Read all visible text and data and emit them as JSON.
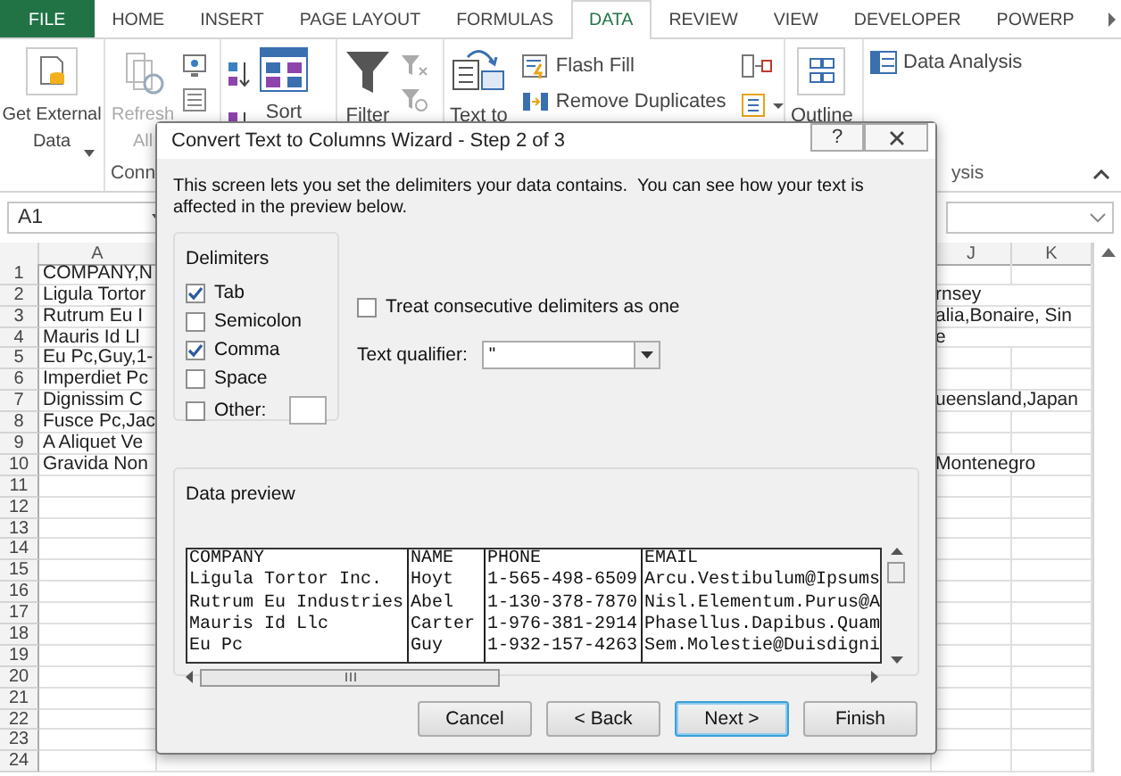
{
  "ribbon": {
    "tabs": [
      {
        "label": "FILE",
        "kind": "file",
        "selected": false
      },
      {
        "label": "HOME",
        "kind": "tab",
        "selected": false
      },
      {
        "label": "INSERT",
        "kind": "tab",
        "selected": false
      },
      {
        "label": "PAGE LAYOUT",
        "kind": "tab",
        "selected": false
      },
      {
        "label": "FORMULAS",
        "kind": "tab",
        "selected": false
      },
      {
        "label": "DATA",
        "kind": "tab",
        "selected": true
      },
      {
        "label": "REVIEW",
        "kind": "tab",
        "selected": false
      },
      {
        "label": "VIEW",
        "kind": "tab",
        "selected": false
      },
      {
        "label": "DEVELOPER",
        "kind": "tab",
        "selected": false
      },
      {
        "label": "POWERP",
        "kind": "tab",
        "selected": false
      }
    ],
    "get_external_data": "Get External Data",
    "refresh_all": {
      "label": "Refresh All",
      "disabled": true
    },
    "sort": "Sort",
    "filter": "Filter",
    "text_to_columns": "Text to",
    "flash_fill": "Flash Fill",
    "remove_duplicates": "Remove Duplicates",
    "outline": "Outline",
    "data_analysis": "Data Analysis",
    "group_labels": [
      "Conn",
      "ysis"
    ]
  },
  "name_box": {
    "value": "A1"
  },
  "sheet": {
    "columns": [
      "A",
      "J",
      "K"
    ],
    "rows": [
      {
        "number": "1",
        "column_a": "COMPANY,N"
      },
      {
        "number": "2",
        "column_a": "Ligula Tortor",
        "column_j": "rnsey"
      },
      {
        "number": "3",
        "column_a": "Rutrum Eu I",
        "column_j": "alia,Bonaire, Sin"
      },
      {
        "number": "4",
        "column_a": "Mauris Id Ll",
        "column_j": "e"
      },
      {
        "number": "5",
        "column_a": "Eu Pc,Guy,1-"
      },
      {
        "number": "6",
        "column_a": "Imperdiet Pc"
      },
      {
        "number": "7",
        "column_a": "Dignissim C",
        "column_j": "ueensland,Japan"
      },
      {
        "number": "8",
        "column_a": "Fusce Pc,Jac"
      },
      {
        "number": "9",
        "column_a": "A Aliquet Ve"
      },
      {
        "number": "10",
        "column_a": "Gravida Non",
        "column_j": "Montenegro"
      },
      {
        "number": "11"
      },
      {
        "number": "12"
      },
      {
        "number": "13"
      },
      {
        "number": "14"
      },
      {
        "number": "15"
      },
      {
        "number": "16"
      },
      {
        "number": "17"
      },
      {
        "number": "18"
      },
      {
        "number": "19"
      },
      {
        "number": "20"
      },
      {
        "number": "21"
      },
      {
        "number": "22"
      },
      {
        "number": "23"
      },
      {
        "number": "24"
      }
    ]
  },
  "dialog": {
    "title": "Convert Text to Columns Wizard - Step 2 of 3",
    "help": "?",
    "intro": "This screen lets you set the delimiters your data contains.  You can see how your text is affected in the preview below.",
    "delimiters": {
      "title": "Delimiters",
      "options": [
        {
          "label": "Tab",
          "checked": true
        },
        {
          "label": "Semicolon",
          "checked": false
        },
        {
          "label": "Comma",
          "checked": true
        },
        {
          "label": "Space",
          "checked": false
        },
        {
          "label": "Other:",
          "checked": false
        }
      ]
    },
    "treat_consecutive": {
      "label": "Treat consecutive delimiters as one",
      "checked": false
    },
    "text_qualifier": {
      "label": "Text qualifier:",
      "value": "\""
    },
    "preview": {
      "title": "Data preview",
      "rows": [
        [
          "COMPANY",
          "NAME",
          "PHONE",
          "EMAIL"
        ],
        [
          "Ligula Tortor Inc.",
          "Hoyt",
          "1-565-498-6509",
          "Arcu.Vestibulum@Ipsums"
        ],
        [
          "Rutrum Eu Industries",
          "Abel",
          "1-130-378-7870",
          "Nisl.Elementum.Purus@A"
        ],
        [
          "Mauris Id Llc",
          "Carter",
          "1-976-381-2914",
          "Phasellus.Dapibus.Quam"
        ],
        [
          "Eu Pc",
          "Guy",
          "1-932-157-4263",
          "Sem.Molestie@Duisdigni"
        ]
      ]
    },
    "buttons": [
      {
        "label": "Cancel",
        "default": false
      },
      {
        "label": "< Back",
        "default": false
      },
      {
        "label": "Next >",
        "default": true
      },
      {
        "label": "Finish",
        "default": false
      }
    ]
  }
}
